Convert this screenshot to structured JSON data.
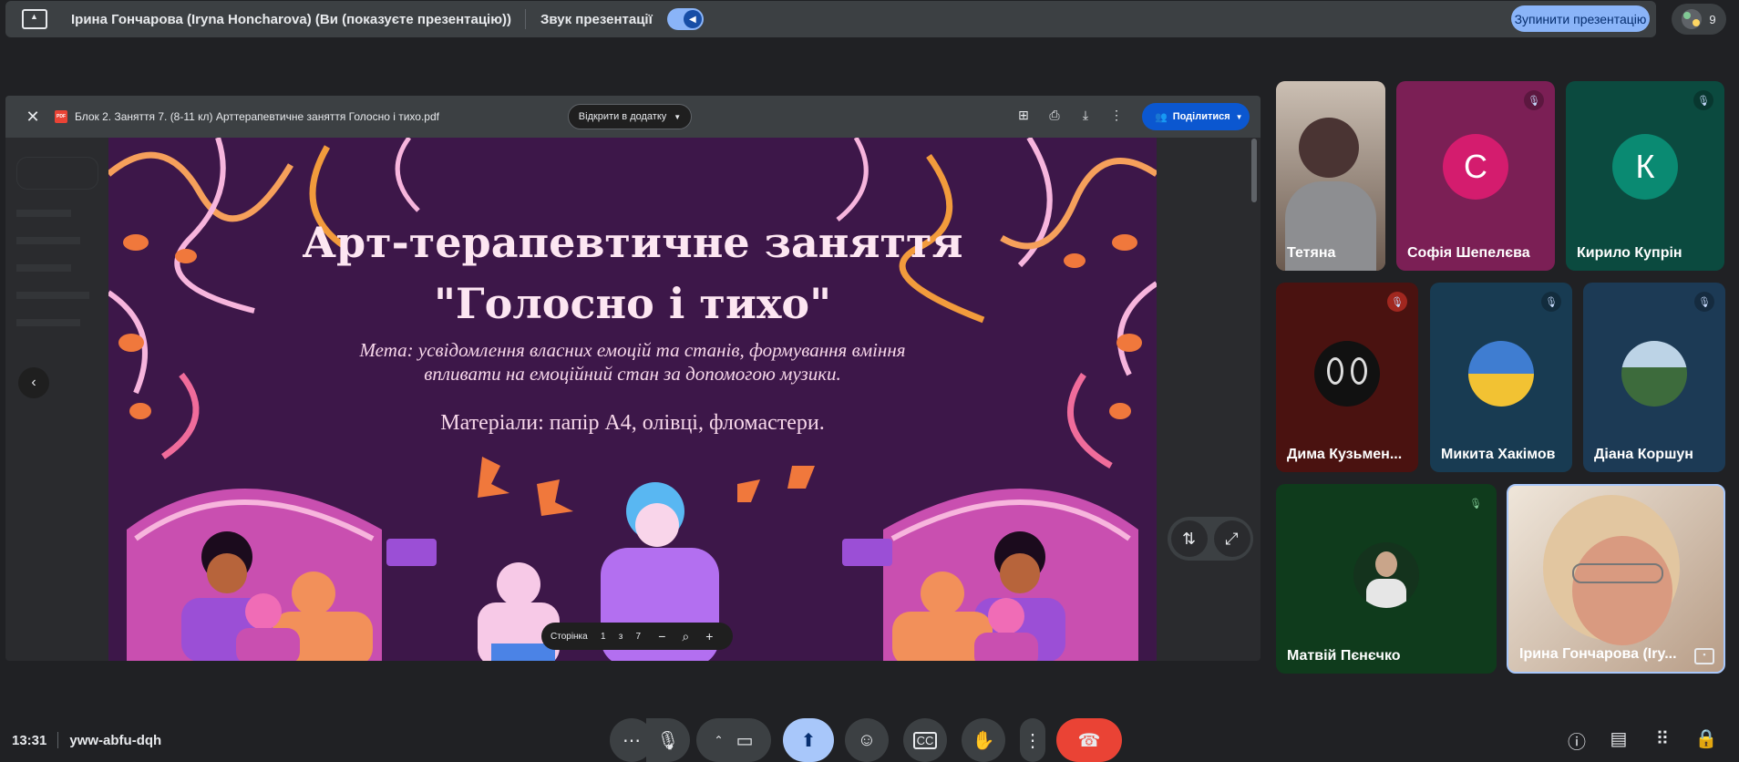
{
  "topbar": {
    "presenter_text": "Ірина Гончарова (Iryna Honcharova) (Ви (показуєте презентацію))",
    "audio_label": "Звук презентації",
    "stop_button": "Зупинити презентацію",
    "participant_count": "9"
  },
  "document": {
    "filename": "Блок 2. Заняття 7. (8-11 кл) Арттерапевтичне заняття Голосно і тихо.pdf",
    "open_with": "Відкрити в додатку",
    "share": "Поділитися"
  },
  "slide": {
    "title_line1": "Арт-терапевтичне заняття",
    "title_line2": "\"Голосно і тихо\"",
    "goal_line1": "Мета: усвідомлення власних емоцій та станів, формування вміння",
    "goal_line2": "впливати на емоційний стан за допомогою музики.",
    "materials": "Матеріали: папір А4, олівці, фломастери."
  },
  "pager": {
    "label": "Сторінка",
    "current": "1",
    "of": "з",
    "total": "7"
  },
  "participants": [
    {
      "name": "Тетяна",
      "muted": false
    },
    {
      "name": "Софія Шепелєва",
      "initial": "С",
      "muted": true
    },
    {
      "name": "Кирило Купрін",
      "initial": "К",
      "muted": true
    },
    {
      "name": "Дима Кузьмен...",
      "muted": true
    },
    {
      "name": "Микита Хакімов",
      "muted": true
    },
    {
      "name": "Діана Коршун",
      "muted": true
    },
    {
      "name": "Матвій Пєнєчко",
      "muted": true
    },
    {
      "name": "Ірина Гончарова (Іry...",
      "muted": false
    }
  ],
  "bottom": {
    "time": "13:31",
    "meeting_code": "yww-abfu-dqh"
  },
  "colors": {
    "accent": "#8ab4f8",
    "end_call": "#ea4335",
    "share_btn": "#0b57d0",
    "slide_bg": "#3d1749"
  }
}
